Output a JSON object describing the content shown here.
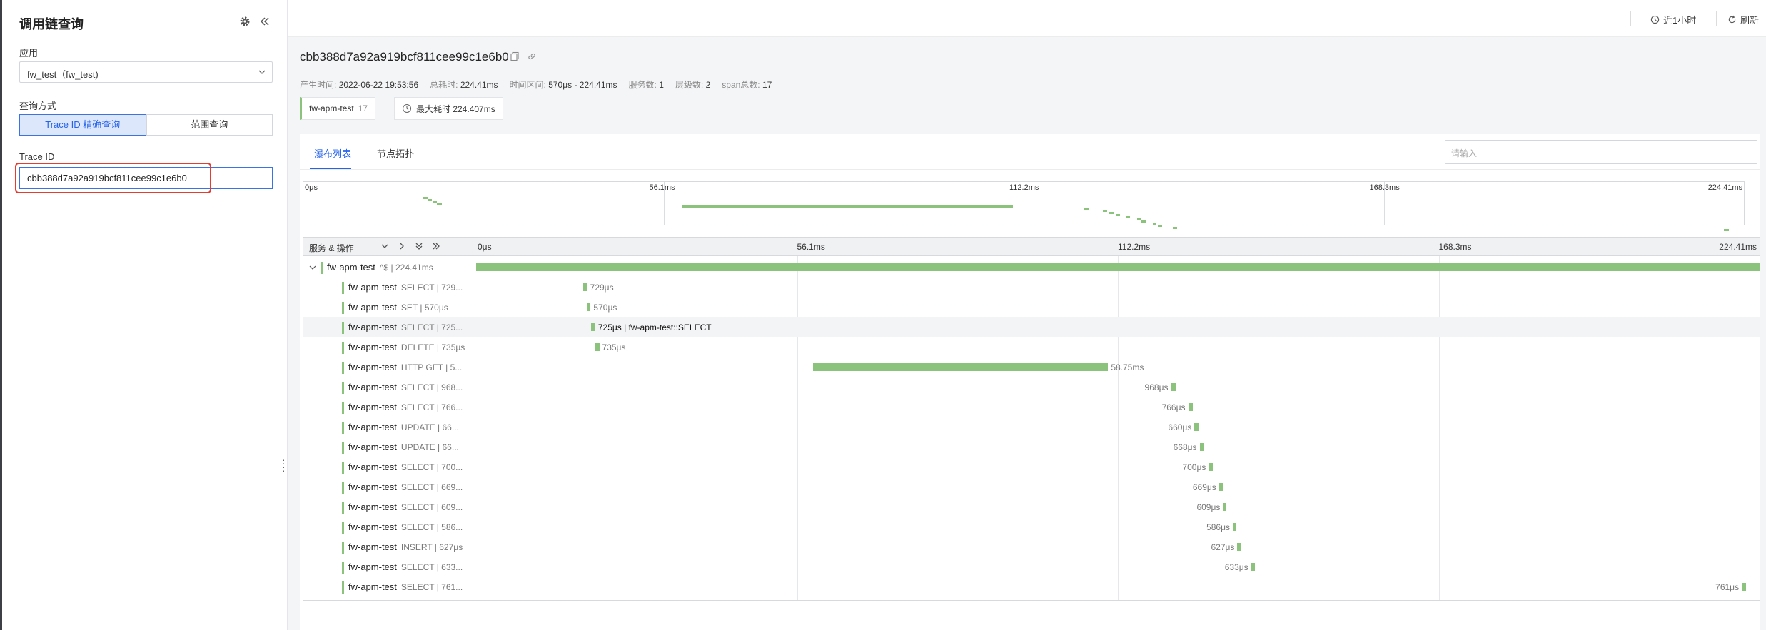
{
  "sidebar": {
    "title": "调用链查询",
    "app_label": "应用",
    "app_value": "fw_test（fw_test)",
    "query_mode_label": "查询方式",
    "mode_exact": "Trace ID 精确查询",
    "mode_range": "范围查询",
    "trace_id_label": "Trace ID",
    "trace_id_value": "cbb388d7a92a919bcf811cee99c1e6b0"
  },
  "topbar": {
    "time_range": "近1小时",
    "refresh": "刷新"
  },
  "header": {
    "trace_id": "cbb388d7a92a919bcf811cee99c1e6b0",
    "meta": [
      {
        "label": "产生时间:",
        "value": "2022-06-22 19:53:56"
      },
      {
        "label": "总耗时:",
        "value": "224.41ms"
      },
      {
        "label": "时间区间:",
        "value": "570μs - 224.41ms"
      },
      {
        "label": "服务数:",
        "value": "1"
      },
      {
        "label": "层级数:",
        "value": "2"
      },
      {
        "label": "span总数:",
        "value": "17"
      }
    ],
    "service_chip": "fw-apm-test",
    "service_count": "17",
    "max_duration": "最大耗时 224.407ms"
  },
  "tabs": {
    "waterfall": "瀑布列表",
    "topology": "节点拓扑",
    "search_placeholder": "请输入"
  },
  "timeline": {
    "total_ms": 224.41,
    "ticks": [
      "0μs",
      "56.1ms",
      "112.2ms",
      "168.3ms",
      "224.41ms"
    ],
    "header_label": "服务 & 操作"
  },
  "spans": [
    {
      "service": "fw-apm-test",
      "op": "^$ | 224.41ms",
      "start_ms": 0,
      "dur_ms": 224.41,
      "label": "",
      "root": true
    },
    {
      "service": "fw-apm-test",
      "op": "SELECT | 729...",
      "start_ms": 18.7,
      "dur_ms": 0.729,
      "label": "729μs"
    },
    {
      "service": "fw-apm-test",
      "op": "SET | 570μs",
      "start_ms": 19.4,
      "dur_ms": 0.57,
      "label": "570μs"
    },
    {
      "service": "fw-apm-test",
      "op": "SELECT | 725...",
      "start_ms": 20.1,
      "dur_ms": 0.725,
      "label": "725μs | fw-apm-test::SELECT",
      "highlight": true
    },
    {
      "service": "fw-apm-test",
      "op": "DELETE | 735μs",
      "start_ms": 20.8,
      "dur_ms": 0.735,
      "label": "735μs"
    },
    {
      "service": "fw-apm-test",
      "op": "HTTP GET | 5...",
      "start_ms": 58.9,
      "dur_ms": 51.6,
      "label": "58.75ms"
    },
    {
      "service": "fw-apm-test",
      "op": "SELECT | 968...",
      "start_ms": 121.5,
      "dur_ms": 0.968,
      "label": "968μs"
    },
    {
      "service": "fw-apm-test",
      "op": "SELECT | 766...",
      "start_ms": 124.5,
      "dur_ms": 0.766,
      "label": "766μs"
    },
    {
      "service": "fw-apm-test",
      "op": "UPDATE | 66...",
      "start_ms": 125.6,
      "dur_ms": 0.66,
      "label": "660μs"
    },
    {
      "service": "fw-apm-test",
      "op": "UPDATE | 66...",
      "start_ms": 126.5,
      "dur_ms": 0.668,
      "label": "668μs"
    },
    {
      "service": "fw-apm-test",
      "op": "SELECT | 700...",
      "start_ms": 128.1,
      "dur_ms": 0.7,
      "label": "700μs"
    },
    {
      "service": "fw-apm-test",
      "op": "SELECT | 669...",
      "start_ms": 129.9,
      "dur_ms": 0.669,
      "label": "669μs"
    },
    {
      "service": "fw-apm-test",
      "op": "SELECT | 609...",
      "start_ms": 130.6,
      "dur_ms": 0.609,
      "label": "609μs"
    },
    {
      "service": "fw-apm-test",
      "op": "SELECT | 586...",
      "start_ms": 132.3,
      "dur_ms": 0.586,
      "label": "586μs"
    },
    {
      "service": "fw-apm-test",
      "op": "INSERT | 627μs",
      "start_ms": 133.1,
      "dur_ms": 0.627,
      "label": "627μs"
    },
    {
      "service": "fw-apm-test",
      "op": "SELECT | 633...",
      "start_ms": 135.5,
      "dur_ms": 0.633,
      "label": "633μs"
    },
    {
      "service": "fw-apm-test",
      "op": "SELECT | 761...",
      "start_ms": 221.3,
      "dur_ms": 0.761,
      "label": "761μs"
    }
  ],
  "colors": {
    "accent": "#2563eb",
    "span_bar": "#8cc37c",
    "annotation": "#e43c2f"
  }
}
